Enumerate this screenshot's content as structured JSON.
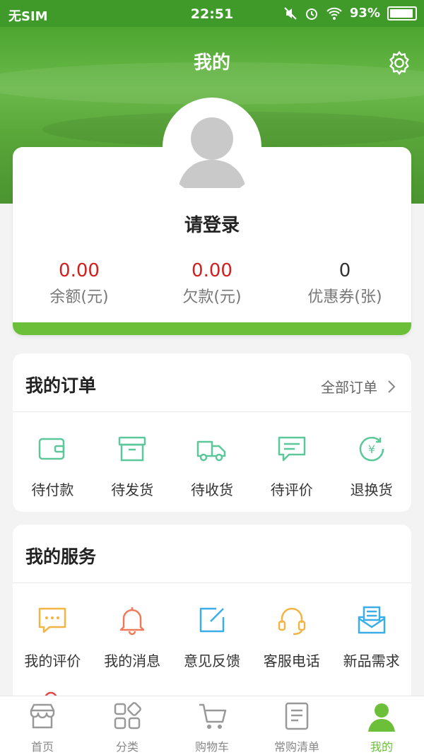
{
  "status": {
    "carrier": "无SIM",
    "time": "22:51",
    "battery": "93%"
  },
  "header": {
    "title": "我的"
  },
  "profile": {
    "login_prompt": "请登录",
    "stats": [
      {
        "value": "0.00",
        "label": "余额(元)",
        "color": "#d02020"
      },
      {
        "value": "0.00",
        "label": "欠款(元)",
        "color": "#d02020"
      },
      {
        "value": "0",
        "label": "优惠券(张)",
        "color": "#333333"
      }
    ]
  },
  "orders": {
    "title": "我的订单",
    "all_link": "全部订单",
    "items": [
      {
        "label": "待付款",
        "icon": "wallet-icon"
      },
      {
        "label": "待发货",
        "icon": "box-icon"
      },
      {
        "label": "待收货",
        "icon": "truck-icon"
      },
      {
        "label": "待评价",
        "icon": "comment-icon"
      },
      {
        "label": "退换货",
        "icon": "yen-return-icon"
      }
    ]
  },
  "services": {
    "title": "我的服务",
    "items": [
      {
        "label": "我的评价",
        "icon": "chat-dots-icon"
      },
      {
        "label": "我的消息",
        "icon": "bell-icon"
      },
      {
        "label": "意见反馈",
        "icon": "edit-icon"
      },
      {
        "label": "客服电话",
        "icon": "headset-icon"
      },
      {
        "label": "新品需求",
        "icon": "mail-list-icon"
      },
      {
        "label": "",
        "icon": "add-user-icon"
      }
    ]
  },
  "tabbar": {
    "items": [
      {
        "label": "首页",
        "icon": "shop-icon"
      },
      {
        "label": "分类",
        "icon": "category-icon"
      },
      {
        "label": "购物车",
        "icon": "cart-icon"
      },
      {
        "label": "常购清单",
        "icon": "list-icon"
      },
      {
        "label": "我的",
        "icon": "user-icon",
        "active": true
      }
    ]
  },
  "colors": {
    "brand_green": "#6cc039",
    "order_icon": "#5bc79a",
    "price_red": "#d02020"
  }
}
